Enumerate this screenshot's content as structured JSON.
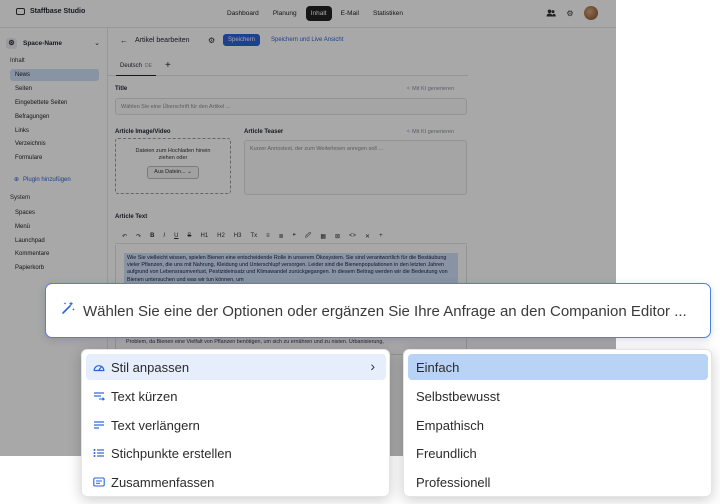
{
  "app": {
    "brand": "Staffbase Studio",
    "nav": [
      "Dashboard",
      "Planung",
      "Inhalt",
      "E-Mail",
      "Statistiken"
    ],
    "active_nav": "Inhalt"
  },
  "sidebar": {
    "space_name": "Space-Name",
    "section_content": "Inhalt",
    "content_items": [
      "News",
      "Seiten",
      "Eingebettete Seiten",
      "Befragungen",
      "Links",
      "Verzeichnis",
      "Formulare"
    ],
    "plugin_label": "Plugin hinzufügen",
    "section_system": "System",
    "system_items": [
      "Spaces",
      "Menü",
      "Launchpad",
      "Kommentare",
      "Papierkorb"
    ]
  },
  "editor": {
    "page_title": "Artikel bearbeiten",
    "save_label": "Speichern",
    "save_live_label": "Speichern und Live Ansicht",
    "language_tab": "Deutsch",
    "language_code": "DE",
    "title_label": "Title",
    "ai_generate": "Mit KI generieren",
    "title_placeholder": "Wählen Sie eine Überschrift für den Artikel ...",
    "image_label": "Article Image/Video",
    "upload_text": "Dateien zum Hochladen hinein ziehen oder",
    "upload_button": "Aus Datein...",
    "teaser_label": "Article Teaser",
    "teaser_placeholder": "Kurzer Anriostext, der zum Weiterlesen anregen soll ...",
    "text_label": "Article Text",
    "tools": [
      "↶",
      "↷",
      "B",
      "I",
      "U",
      "S",
      "H1",
      "H2",
      "H3",
      "Tx",
      "≡",
      "≣",
      "❞",
      "🖉",
      "▦",
      "⊠",
      "<>",
      "✕",
      "+"
    ],
    "selected_text": "Wie Sie vielleicht wissen, spielen Bienen eine entscheidende Rolle in unserem Ökosystem. Sie sind verantwortlich für die Bestäubung vieler Pflanzen, die uns mit Nahrung, Kleidung und Unterschlupf versorgen. Leider sind die Bienenpopulationen in den letzten Jahren aufgrund von Lebensraumverlust, Pestizideinsatz und Klimawandel zurückgegangen. In diesem Beitrag werden wir die Bedeutung von Bienen untersuchen und was wir tun können, um",
    "lower_text": "Problem, da Bienen eine Vielfalt von Pflanzen benötigen, um sich zu ernähren und zu nisten. Urbanisierung,"
  },
  "prompt": {
    "text": "Wählen Sie eine der Optionen oder ergänzen Sie Ihre Anfrage an den Companion Editor ..."
  },
  "menu_left": [
    {
      "label": "Stil anpassen",
      "icon": "gauge-icon"
    },
    {
      "label": "Text kürzen",
      "icon": "shorten-icon"
    },
    {
      "label": "Text verlängern",
      "icon": "lengthen-icon"
    },
    {
      "label": "Stichpunkte erstellen",
      "icon": "bullet-list-icon"
    },
    {
      "label": "Zusammenfassen",
      "icon": "summary-icon"
    }
  ],
  "menu_right": [
    {
      "label": "Einfach"
    },
    {
      "label": "Selbstbewusst"
    },
    {
      "label": "Empathisch"
    },
    {
      "label": "Freundlich"
    },
    {
      "label": "Professionell"
    }
  ],
  "colors": {
    "accent": "#2b63d9",
    "selection": "#b9d3f7",
    "hover": "#e6eefc",
    "prompt_border": "#4c7fe0"
  }
}
